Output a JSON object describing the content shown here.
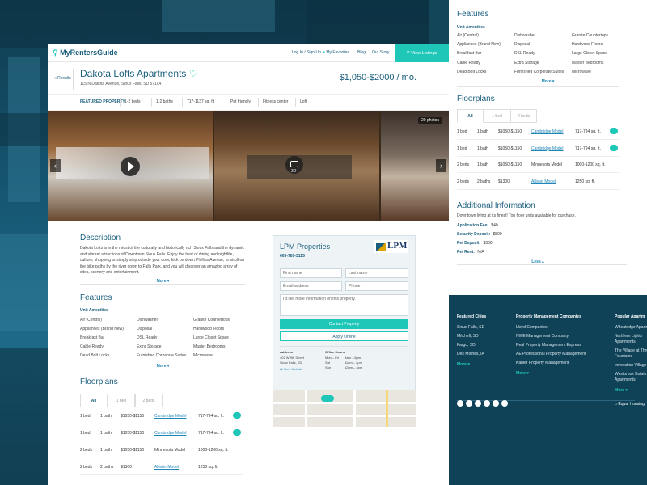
{
  "brand": {
    "name": "MyRentersGuide",
    "accent": "#1fc7b8",
    "primary": "#1a5e7d"
  },
  "nav": {
    "login": "Log In / Sign Up",
    "favorites": "My Favorites",
    "blog": "Blog",
    "story": "Our Story",
    "view_listings": "View Listings"
  },
  "listing": {
    "back": "« Results",
    "title": "Dakota Lofts Apartments",
    "address": "115 N Dakota Avenue, Sioux Falls, SD 57104",
    "price": "$1,050-$2000 / mo.",
    "tags": [
      "FEATURED PROPERTY",
      "1-2 beds",
      "1-2 baths",
      "717-1137 sq. ft.",
      "Pet friendly",
      "Fitness center",
      "Loft"
    ],
    "photo_count": "20 photos",
    "label_3d": "3D"
  },
  "description": {
    "title": "Description",
    "text": "Dakota Lofts is in the midst of the culturally and historically rich Sioux Falls and the dynamic and vibrant attractions of Downtown Sioux Falls. Enjoy the best of dining and nightlife, culture, shopping or simply step outside your door, kick on down Phillips Avenue, or stroll on the bike paths by the river down to Falls Park, and you will discover an amazing array of sites, scenery and entertainment.",
    "more": "More"
  },
  "features": {
    "title": "Features",
    "subtitle": "Unit Amenities",
    "col1": [
      "Air (Central)",
      "Appliances (Brand New)",
      "Breakfast Bar",
      "Cable Ready",
      "Dead Bolt Locks"
    ],
    "col2": [
      "Dishwasher",
      "Disposal",
      "DSL Ready",
      "Extra Storage",
      "Furnished Corporate Suites"
    ],
    "col3": [
      "Granite Countertops",
      "Hardwood Floors",
      "Large Closet Space",
      "Master Bedrooms",
      "Microwave"
    ],
    "more": "More"
  },
  "floorplans": {
    "title": "Floorplans",
    "tabs": [
      "All",
      "1 bed",
      "2 beds"
    ],
    "rows": [
      {
        "beds": "1 bed",
        "baths": "1 bath",
        "price": "$1050-$1150",
        "model": "Cambridge Model",
        "link": true,
        "sqft": "717-794 sq. ft.",
        "icon": true
      },
      {
        "beds": "1 bed",
        "baths": "1 bath",
        "price": "$1050-$1150",
        "model": "Cambridge Model",
        "link": true,
        "sqft": "717-794 sq. ft.",
        "icon": true
      },
      {
        "beds": "2 beds",
        "baths": "1 bath",
        "price": "$1050-$1150",
        "model": "Minnesota Model",
        "link": false,
        "sqft": "1000-1200 sq. ft.",
        "icon": false
      },
      {
        "beds": "2 beds",
        "baths": "2 baths",
        "price": "$1300",
        "model": "Allister Model",
        "link": true,
        "sqft": "1250 sq. ft.",
        "icon": false
      }
    ]
  },
  "contact": {
    "company": "LPM Properties",
    "phone": "605-789-3115",
    "logo_text": "LPM",
    "first_name": "First name",
    "last_name": "Last name",
    "email": "Email address",
    "phone_ph": "Phone",
    "message": "I'd like more information on this property.",
    "contact_btn": "Contact Property",
    "apply_btn": "Apply Online",
    "address_label": "Address",
    "address_lines": [
      "402 W 9th Street",
      "Sioux Falls, SD"
    ],
    "view_website": "View Website",
    "hours_label": "Office Hours",
    "hours": [
      [
        "Mon – Fri",
        "9am – 6pm"
      ],
      [
        "Sat",
        "11am – 4pm"
      ],
      [
        "Sun",
        "12pm – 4pm"
      ]
    ]
  },
  "additional": {
    "title": "Additional Information",
    "intro": "Downtown living at its finest! Top floor units available for purchase.",
    "fees": [
      {
        "label": "Application Fee:",
        "value": "$40"
      },
      {
        "label": "Security Deposit:",
        "value": "$500"
      },
      {
        "label": "Pet Deposit:",
        "value": "$500"
      },
      {
        "label": "Pet Rent:",
        "value": "N/A"
      }
    ],
    "less": "Less"
  },
  "footer": {
    "cities_title": "Featured Cities",
    "cities": [
      "Sioux Falls, SD",
      "Mitchell, SD",
      "Fargo, SD",
      "Des Moines, IA"
    ],
    "companies_title": "Property Management Companies",
    "companies": [
      "Lloyd Companies",
      "NWE Management Company",
      "Real Property Management Express",
      "AE Professional Property Management",
      "Kahler Property Management"
    ],
    "popular_title": "Popular Apartm",
    "popular": [
      "Wheatridge Apartm",
      "Northern Lights Apartments",
      "The Village at Thre Fountains",
      "Innovation Village",
      "Westbrook Estate Apartments"
    ],
    "more": "More",
    "equal_housing": "Equal Housing"
  }
}
